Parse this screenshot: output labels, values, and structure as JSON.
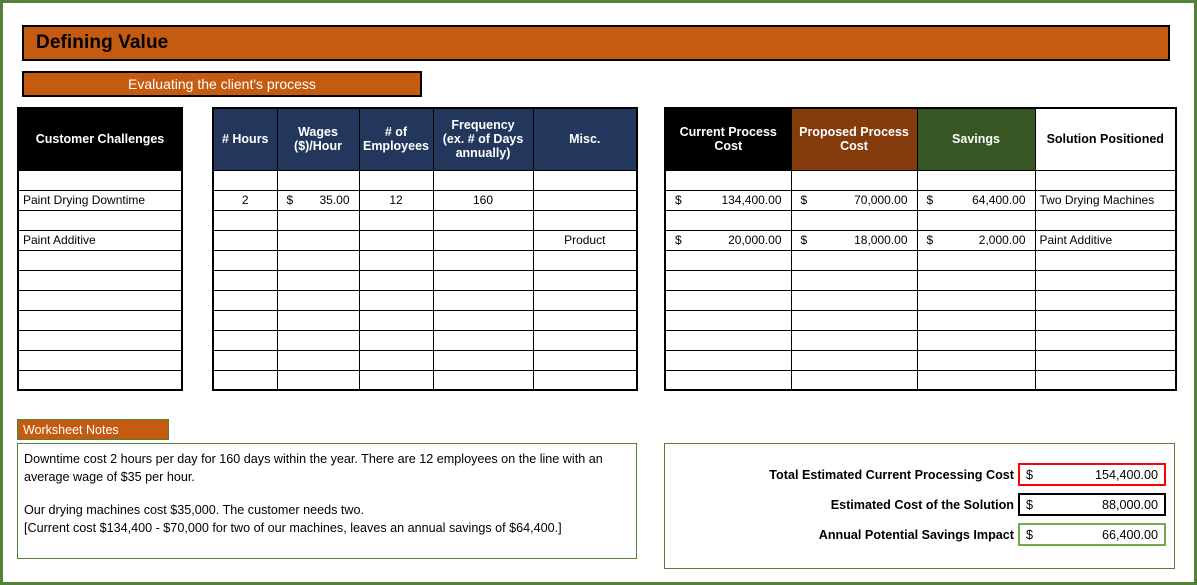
{
  "header": {
    "title": "Defining Value",
    "subtitle": "Evaluating the client's process"
  },
  "challenges_table": {
    "header": "Customer Challenges",
    "rows": [
      "",
      "Paint Drying Downtime",
      "",
      "Paint Additive",
      "",
      "",
      "",
      "",
      "",
      "",
      ""
    ]
  },
  "metrics_table": {
    "headers": [
      "# Hours",
      "Wages ($)/Hour",
      "# of Employees",
      "Frequency (ex. # of Days annually)",
      "Misc."
    ],
    "headers_multiline": {
      "hours": "# Hours",
      "wages_line1": "Wages",
      "wages_line2": "($)/Hour",
      "employees_line1": "# of",
      "employees_line2": "Employees",
      "frequency_line1": "Frequency",
      "frequency_line2": "(ex. # of Days",
      "frequency_line3": "annually)",
      "misc": "Misc."
    },
    "rows": [
      {
        "hours": "",
        "wages_sym": "",
        "wages_val": "",
        "employees": "",
        "frequency": "",
        "misc": ""
      },
      {
        "hours": "2",
        "wages_sym": "$",
        "wages_val": "35.00",
        "employees": "12",
        "frequency": "160",
        "misc": ""
      },
      {
        "hours": "",
        "wages_sym": "",
        "wages_val": "",
        "employees": "",
        "frequency": "",
        "misc": ""
      },
      {
        "hours": "",
        "wages_sym": "",
        "wages_val": "",
        "employees": "",
        "frequency": "",
        "misc": "Product"
      },
      {
        "hours": "",
        "wages_sym": "",
        "wages_val": "",
        "employees": "",
        "frequency": "",
        "misc": ""
      },
      {
        "hours": "",
        "wages_sym": "",
        "wages_val": "",
        "employees": "",
        "frequency": "",
        "misc": ""
      },
      {
        "hours": "",
        "wages_sym": "",
        "wages_val": "",
        "employees": "",
        "frequency": "",
        "misc": ""
      },
      {
        "hours": "",
        "wages_sym": "",
        "wages_val": "",
        "employees": "",
        "frequency": "",
        "misc": ""
      },
      {
        "hours": "",
        "wages_sym": "",
        "wages_val": "",
        "employees": "",
        "frequency": "",
        "misc": ""
      },
      {
        "hours": "",
        "wages_sym": "",
        "wages_val": "",
        "employees": "",
        "frequency": "",
        "misc": ""
      },
      {
        "hours": "",
        "wages_sym": "",
        "wages_val": "",
        "employees": "",
        "frequency": "",
        "misc": ""
      }
    ]
  },
  "costs_table": {
    "headers": {
      "current_line1": "Current Process",
      "current_line2": "Cost",
      "proposed_line1": "Proposed Process",
      "proposed_line2": "Cost",
      "savings": "Savings",
      "solution": "Solution Positioned"
    },
    "rows": [
      {
        "current_sym": "",
        "current_val": "",
        "proposed_sym": "",
        "proposed_val": "",
        "savings_sym": "",
        "savings_val": "",
        "solution": ""
      },
      {
        "current_sym": "$",
        "current_val": "134,400.00",
        "proposed_sym": "$",
        "proposed_val": "70,000.00",
        "savings_sym": "$",
        "savings_val": "64,400.00",
        "solution": "Two Drying Machines"
      },
      {
        "current_sym": "",
        "current_val": "",
        "proposed_sym": "",
        "proposed_val": "",
        "savings_sym": "",
        "savings_val": "",
        "solution": ""
      },
      {
        "current_sym": "$",
        "current_val": "20,000.00",
        "proposed_sym": "$",
        "proposed_val": "18,000.00",
        "savings_sym": "$",
        "savings_val": "2,000.00",
        "solution": "Paint Additive"
      },
      {
        "current_sym": "",
        "current_val": "",
        "proposed_sym": "",
        "proposed_val": "",
        "savings_sym": "",
        "savings_val": "",
        "solution": ""
      },
      {
        "current_sym": "",
        "current_val": "",
        "proposed_sym": "",
        "proposed_val": "",
        "savings_sym": "",
        "savings_val": "",
        "solution": ""
      },
      {
        "current_sym": "",
        "current_val": "",
        "proposed_sym": "",
        "proposed_val": "",
        "savings_sym": "",
        "savings_val": "",
        "solution": ""
      },
      {
        "current_sym": "",
        "current_val": "",
        "proposed_sym": "",
        "proposed_val": "",
        "savings_sym": "",
        "savings_val": "",
        "solution": ""
      },
      {
        "current_sym": "",
        "current_val": "",
        "proposed_sym": "",
        "proposed_val": "",
        "savings_sym": "",
        "savings_val": "",
        "solution": ""
      },
      {
        "current_sym": "",
        "current_val": "",
        "proposed_sym": "",
        "proposed_val": "",
        "savings_sym": "",
        "savings_val": "",
        "solution": ""
      },
      {
        "current_sym": "",
        "current_val": "",
        "proposed_sym": "",
        "proposed_val": "",
        "savings_sym": "",
        "savings_val": "",
        "solution": ""
      }
    ]
  },
  "notes": {
    "badge": "Worksheet Notes",
    "line1": "Downtime cost 2 hours per day for 160 days within the year. There are 12 employees on the line with an average wage of $35 per hour.",
    "line2": "Our drying machines cost $35,000. The customer needs two.",
    "line3": "[Current cost $134,400 - $70,000 for two of our machines, leaves an annual savings of $64,400.]"
  },
  "summary": {
    "rows": [
      {
        "label": "Total Estimated Current Processing Cost",
        "sym": "$",
        "value": "154,400.00",
        "border": "red"
      },
      {
        "label": "Estimated Cost of the Solution",
        "sym": "$",
        "value": "88,000.00",
        "border": "black"
      },
      {
        "label": "Annual Potential Savings Impact",
        "sym": "$",
        "value": "66,400.00",
        "border": "green"
      }
    ]
  },
  "colors": {
    "accent_orange": "#C55A11",
    "header_navy": "#22375B",
    "header_brown": "#843C0C",
    "header_green": "#375623",
    "header_black": "#000000",
    "border_green": "#538135",
    "alert_red": "#FF0000",
    "positive_green": "#70AD47"
  }
}
